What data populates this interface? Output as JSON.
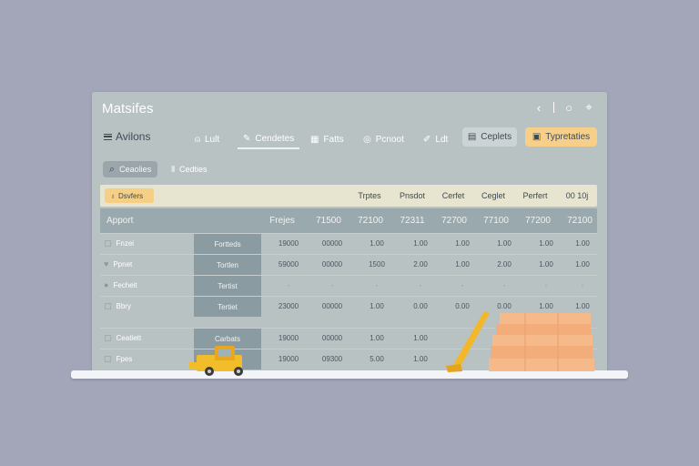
{
  "window": {
    "title": "Matsifes",
    "controls": [
      "back-icon",
      "circle-icon",
      "pin-icon"
    ]
  },
  "toolbar": {
    "menu_label": "Avilons",
    "tabs": [
      {
        "label": "Lult",
        "icon": "person-icon"
      },
      {
        "label": "Cendetes",
        "icon": "edit-icon"
      },
      {
        "label": "Fatts",
        "icon": "grid-icon"
      },
      {
        "label": "Pcnoot",
        "icon": "palette-icon"
      },
      {
        "label": "Ldt",
        "icon": "pen-icon"
      }
    ],
    "copies_label": "Ceplets",
    "templates_label": "Typretaties"
  },
  "filters": {
    "search_chip": "Ceaolies",
    "secondary_chip": "Cedties"
  },
  "table": {
    "badge": "Dsvfers",
    "columns": [
      "Trptes",
      "Pnsdot",
      "Cerfet",
      "Ceglet",
      "Perfert",
      "00 10j"
    ],
    "summary": {
      "label": "Apport",
      "first": "Frejes",
      "values": [
        "71500",
        "72100",
        "72311",
        "72700",
        "77100",
        "77200",
        "72100"
      ]
    },
    "rows": [
      {
        "name": "Fnzei",
        "tag": "Fortteds",
        "values": [
          "19000",
          "00000",
          "1.00",
          "1.00",
          "1.00",
          "1.00",
          "1.00",
          "1.00"
        ]
      },
      {
        "name": "Ppnet",
        "tag": "Tortlen",
        "values": [
          "59000",
          "00000",
          "1500",
          "2.00",
          "1.00",
          "2.00",
          "1.00",
          "1.00"
        ]
      },
      {
        "name": "Fecheit",
        "tag": "Tertist",
        "values": [
          "-",
          "-",
          "-",
          "-",
          "-",
          "-",
          "-",
          "-"
        ]
      },
      {
        "name": "Bbry",
        "tag": "Tertiet",
        "values": [
          "23000",
          "00000",
          "1.00",
          "0.00",
          "0.00",
          "0.00",
          "1.00",
          "1.00"
        ]
      },
      {
        "name": "Ceatiett",
        "tag": "Carbats",
        "values": [
          "19000",
          "00000",
          "1.00",
          "1.00",
          "",
          "",
          "",
          ""
        ]
      },
      {
        "name": "Fpes",
        "tag": "",
        "values": [
          "19000",
          "09300",
          "5.00",
          "1.00",
          "",
          "",
          "",
          ""
        ]
      }
    ]
  },
  "colors": {
    "background": "#a3a6b8",
    "panel": "#b9c2c3",
    "accent": "#f7cf88",
    "header_band": "#e7e4cf",
    "summary_band": "#9aa9ae",
    "tag_column": "#8b9ba2"
  }
}
